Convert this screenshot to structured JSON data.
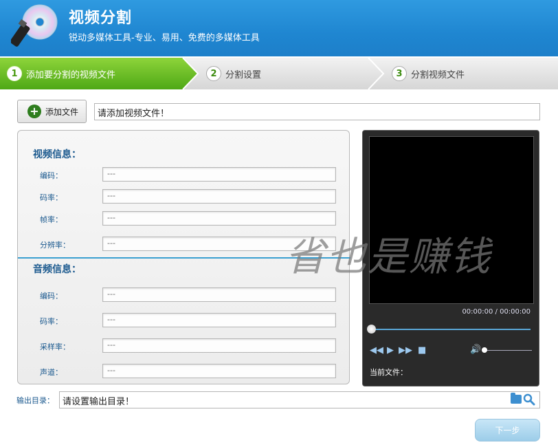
{
  "header": {
    "title": "视频分割",
    "subtitle": "锐动多媒体工具-专业、易用、免费的多媒体工具"
  },
  "steps": [
    {
      "num": "1",
      "label": "添加要分割的视频文件"
    },
    {
      "num": "2",
      "label": "分割设置"
    },
    {
      "num": "3",
      "label": "分割视频文件"
    }
  ],
  "add_file": {
    "button_label": "添加文件",
    "field_value": "请添加视频文件！"
  },
  "video_info": {
    "title": "视频信息：",
    "fields": [
      {
        "label": "编码：",
        "value": "---"
      },
      {
        "label": "码率：",
        "value": "---"
      },
      {
        "label": "帧率：",
        "value": "---"
      },
      {
        "label": "分辨率：",
        "value": "---"
      }
    ]
  },
  "audio_info": {
    "title": "音频信息：",
    "fields": [
      {
        "label": "编码：",
        "value": "---"
      },
      {
        "label": "码率：",
        "value": "---"
      },
      {
        "label": "采样率：",
        "value": "---"
      },
      {
        "label": "声道：",
        "value": "---"
      }
    ]
  },
  "player": {
    "time": "00:00:00 / 00:00:00",
    "current_file_label": "当前文件：",
    "seek_progress": 0
  },
  "output": {
    "label": "输出目录：",
    "value": "请设置输出目录！"
  },
  "next_button": "下一步",
  "watermark": "省也是赚钱",
  "colors": {
    "header_blue": "#1f86d1",
    "step_active_green": "#5ab81a",
    "label_blue": "#1c5a8f",
    "divider_blue": "#3a9fd0"
  }
}
